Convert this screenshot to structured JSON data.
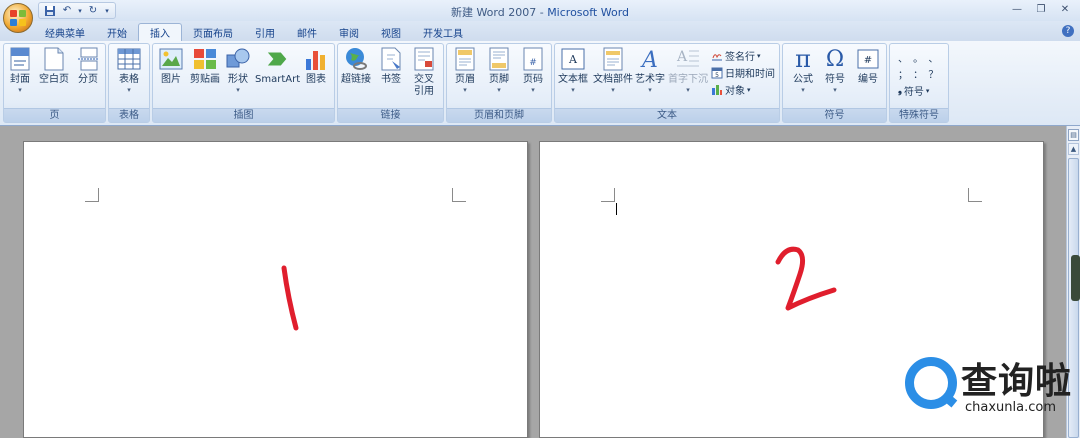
{
  "window": {
    "title_doc": "新建 Word 2007",
    "title_sep": " - ",
    "title_app": "Microsoft Word"
  },
  "tabs": [
    "经典菜单",
    "开始",
    "插入",
    "页面布局",
    "引用",
    "邮件",
    "审阅",
    "视图",
    "开发工具"
  ],
  "active_tab": "插入",
  "ribbon": {
    "page_group": {
      "label": "页",
      "cover": "封面",
      "blank": "空白页",
      "break": "分页"
    },
    "table_group": {
      "label": "表格",
      "table": "表格"
    },
    "illustration_group": {
      "label": "插图",
      "picture": "图片",
      "clipart": "剪贴画",
      "shapes": "形状",
      "smartart": "SmartArt",
      "chart": "图表"
    },
    "link_group": {
      "label": "链接",
      "hyperlink": "超链接",
      "bookmark": "书签",
      "crossref_1": "交叉",
      "crossref_2": "引用"
    },
    "header_footer_group": {
      "label": "页眉和页脚",
      "header": "页眉",
      "footer": "页脚",
      "page_number": "页码"
    },
    "text_group": {
      "label": "文本",
      "textbox": "文本框",
      "quickparts": "文档部件",
      "wordart": "艺术字",
      "dropcap": "首字下沉",
      "signature": "签名行",
      "datetime": "日期和时间",
      "object": "对象"
    },
    "symbol_group": {
      "label": "符号",
      "equation": "公式",
      "symbol": "符号",
      "number": "编号"
    },
    "special_group": {
      "label": "特殊符号",
      "row1": "、 。 、",
      "row2": "； ： ？",
      "symbol": "符号"
    }
  },
  "pages": [
    {
      "content": "1",
      "ink_color": "#e01e2d"
    },
    {
      "content": "2",
      "ink_color": "#e01e2d"
    }
  ],
  "watermark": {
    "brand": "查询啦",
    "url": "chaxunla.com",
    "color": "#2b8ee6"
  },
  "colors": {
    "accent": "#2050a0",
    "ribbon_bg": "#dde8f5",
    "workspace": "#a6a6a6"
  }
}
